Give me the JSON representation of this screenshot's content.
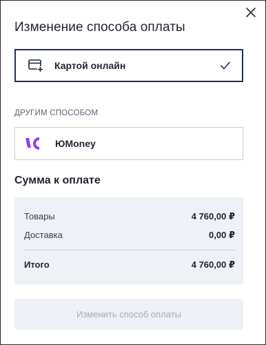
{
  "modal": {
    "title": "Изменение способа оплаты"
  },
  "icons": {
    "close": "close-icon",
    "card": "card-add-icon",
    "check": "check-icon",
    "yumoney": "yumoney-logo-icon"
  },
  "payment_methods": {
    "selected": {
      "label": "Картой онлайн",
      "checked": true
    },
    "other_section_label": "ДРУГИМ СПОСОБОМ",
    "other": {
      "label": "ЮMoney",
      "logo_color": "#8b3ffd"
    }
  },
  "summary": {
    "title": "Сумма к оплате",
    "rows": [
      {
        "label": "Товары",
        "value": "4 760,00 ₽"
      },
      {
        "label": "Доставка",
        "value": "0,00 ₽"
      }
    ],
    "total": {
      "label": "Итого",
      "value": "4 760,00 ₽"
    }
  },
  "submit_button": {
    "label": "Изменить способ оплаты",
    "enabled": false
  },
  "colors": {
    "accent_border": "#1d2e63",
    "summary_bg": "#eef1f6",
    "disabled_text": "#a7adb8"
  }
}
